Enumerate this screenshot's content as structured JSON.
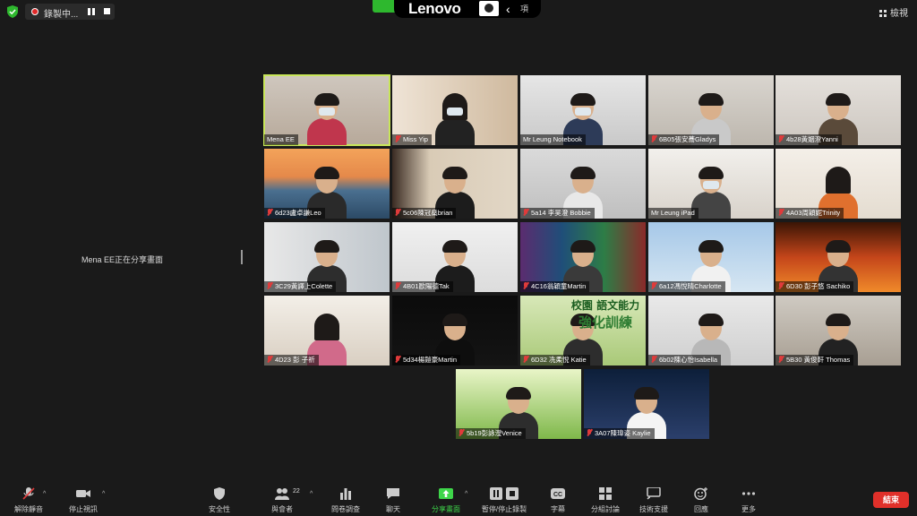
{
  "top_bar": {
    "recording_label": "錄製中...",
    "view_label": "檢視",
    "lenovo_brand": "Lenovo",
    "lenovo_option": "項"
  },
  "share_notice": "Mena  EE正在分享畫面",
  "participants": [
    {
      "name": "Mena EE",
      "muted": false,
      "active": true
    },
    {
      "name": "Miss Yip",
      "muted": true
    },
    {
      "name": "Mr Leung Notebook",
      "muted": false
    },
    {
      "name": "6B05張安蕎Gladys",
      "muted": true
    },
    {
      "name": "4b28黃姻澄Yanni",
      "muted": true
    },
    {
      "name": "6d23盧卓謙Leo",
      "muted": true
    },
    {
      "name": "5c06陳冠燊brian",
      "muted": true
    },
    {
      "name": "5a14 李昊澄 Bobbie",
      "muted": true
    },
    {
      "name": "Mr Leung iPad",
      "muted": false
    },
    {
      "name": "4A03周穎妮Trinity",
      "muted": true
    },
    {
      "name": "3C29黃譯上Colette",
      "muted": true
    },
    {
      "name": "4B01歐陽德Tak",
      "muted": true
    },
    {
      "name": "4C16翁穎童Martin",
      "muted": true
    },
    {
      "name": "6a12馮悅晴Charlotte",
      "muted": true
    },
    {
      "name": "6D30 彭子悠 Sachiko",
      "muted": true
    },
    {
      "name": "4D23 彭 子祈",
      "muted": true
    },
    {
      "name": "5d34楊鎧豪Martin",
      "muted": true
    },
    {
      "name": "6D32 冼柔悅 Katie",
      "muted": true
    },
    {
      "name": "6b02陳心怡Isabella",
      "muted": true
    },
    {
      "name": "5B30 黃俊軒 Thomas",
      "muted": true
    },
    {
      "name": "5b19彭詠瀅Venice",
      "muted": true
    },
    {
      "name": "3A07陳瑋姿 Kaylie",
      "muted": true
    }
  ],
  "banner_text": {
    "line1": "校園 語文能力",
    "line2": "強化訓練"
  },
  "toolbar": {
    "unmute": "解除靜音",
    "stop_video": "停止視訊",
    "security": "安全性",
    "participants": "與會者",
    "participants_count": "22",
    "polls": "問卷調查",
    "chat": "聊天",
    "share_screen": "分享畫面",
    "record": "暫停/停止錄製",
    "captions": "字幕",
    "breakout": "分組討論",
    "tech_support": "技術支援",
    "reactions": "回應",
    "more": "更多",
    "end": "結束"
  },
  "colors": {
    "accent_green": "#3ed64a",
    "end_red": "#e0302a",
    "active_border": "#c8e65a",
    "muted_red": "#e03b3b"
  }
}
